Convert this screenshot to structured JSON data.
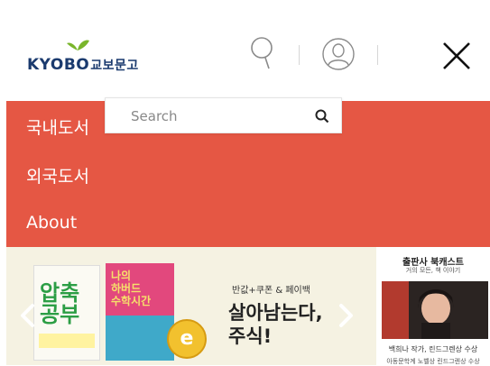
{
  "header": {
    "logo_en": "KYOBO",
    "logo_ko": "교보문고",
    "icons": [
      "search-icon",
      "user-icon",
      "close-icon"
    ]
  },
  "menu": {
    "items": [
      {
        "label": "국내도서"
      },
      {
        "label": "외국도서"
      },
      {
        "label": "About"
      }
    ]
  },
  "search": {
    "placeholder": "Search",
    "value": ""
  },
  "banner": {
    "book1_title": "압축\n공부",
    "book2_title": "나의\n하버드\n수학시간",
    "coin_label": "e",
    "promo_small": "반값+쿠폰 & 페이백",
    "promo_big": "살아남는다,\n주식!"
  },
  "podcast": {
    "title": "출판사 북캐스트",
    "subtitle": "거의 모든, 책 이야기",
    "caption": "백희나 작가, 린드그렌상 수상",
    "caption2": "아동문학계 노벨상 린드그렌상 수상"
  },
  "colors": {
    "menu_bg": "#e55744",
    "logo_text": "#1a3a6e",
    "logo_leaf": "#79b52b",
    "banner_bg": "#f5f2e2"
  }
}
